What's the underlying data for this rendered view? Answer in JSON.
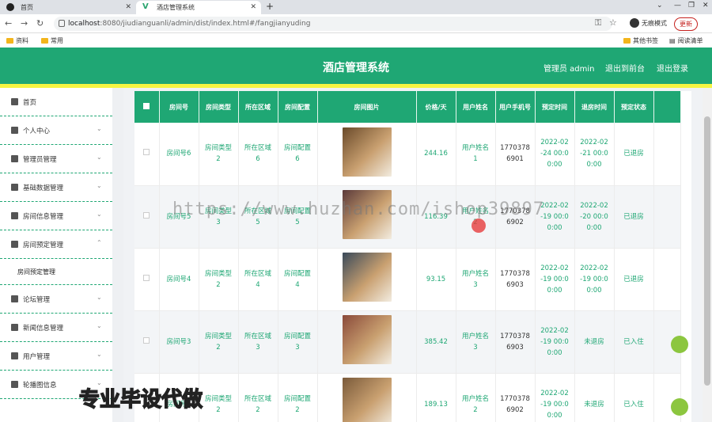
{
  "browser": {
    "tabs": [
      {
        "label": "首页"
      },
      {
        "label": "酒店管理系统"
      }
    ],
    "url_host": "localhost",
    "url_rest": ":8080/jiudianguanli/admin/dist/index.html#/fangjianyuding",
    "incognito_label": "无痕模式",
    "update_label": "更新",
    "bookmarks": [
      "资料",
      "常用"
    ],
    "bookmarks_right": [
      "其他书签",
      "阅读清单"
    ]
  },
  "header": {
    "title": "酒店管理系统",
    "admin": "管理员 admin",
    "back_front": "退出到前台",
    "logout": "退出登录"
  },
  "sidebar": {
    "items": [
      {
        "label": "首页",
        "icon": "home-icon",
        "chevron": false
      },
      {
        "label": "个人中心",
        "icon": "user-icon",
        "chevron": true
      },
      {
        "label": "管理员管理",
        "icon": "chart-icon",
        "chevron": true
      },
      {
        "label": "基础数据管理",
        "icon": "chat-icon",
        "chevron": true
      },
      {
        "label": "房间信息管理",
        "icon": "grid-icon",
        "chevron": true
      },
      {
        "label": "房间预定管理",
        "icon": "briefcase-icon",
        "chevron": true,
        "expanded": true
      },
      {
        "label": "论坛管理",
        "icon": "pin-icon",
        "chevron": true
      },
      {
        "label": "新闻信息管理",
        "icon": "news-icon",
        "chevron": true
      },
      {
        "label": "用户管理",
        "icon": "sliders-icon",
        "chevron": true
      },
      {
        "label": "轮播图信息",
        "icon": "bowtie-icon",
        "chevron": true
      }
    ],
    "subitem": "房间预定管理"
  },
  "table": {
    "headers": [
      "房间号",
      "房间类型",
      "所在区域",
      "房间配置",
      "房间图片",
      "价格/天",
      "用户姓名",
      "用户手机号",
      "预定时间",
      "退房时间",
      "预定状态"
    ],
    "rows": [
      {
        "room": "房间号6",
        "type": "房间类型\n2",
        "area": "所在区域\n6",
        "config": "房间配置\n6",
        "price": "244.16",
        "user": "用户姓名\n1",
        "phone": "1770378\n6901",
        "book": "2022-02\n-24 00:0\n0:00",
        "checkout": "2022-02\n-21 00:0\n0:00",
        "status": "已退房",
        "photo": "#6a4a2a"
      },
      {
        "room": "房间号5",
        "type": "房间类型\n3",
        "area": "所在区域\n5",
        "config": "房间配置\n5",
        "price": "116.39",
        "user": "用户姓名\n2",
        "phone": "1770378\n6902",
        "book": "2022-02\n-19 00:0\n0:00",
        "checkout": "2022-02\n-20 00:0\n0:00",
        "status": "已退房",
        "photo": "#5b3a3a"
      },
      {
        "room": "房间号4",
        "type": "房间类型\n2",
        "area": "所在区域\n4",
        "config": "房间配置\n4",
        "price": "93.15",
        "user": "用户姓名\n3",
        "phone": "1770378\n6903",
        "book": "2022-02\n-19 00:0\n0:00",
        "checkout": "2022-02\n-19 00:0\n0:00",
        "status": "已退房",
        "photo": "#3a4a5a"
      },
      {
        "room": "房间号3",
        "type": "房间类型\n2",
        "area": "所在区域\n3",
        "config": "房间配置\n3",
        "price": "385.42",
        "user": "用户姓名\n3",
        "phone": "1770378\n6903",
        "book": "2022-02\n-19 00:0\n0:00",
        "checkout": "未退房",
        "status": "已入住",
        "photo": "#8a4a3a"
      },
      {
        "room": "房间号2",
        "type": "房间类型\n2",
        "area": "所在区域\n2",
        "config": "房间配置\n2",
        "price": "189.13",
        "user": "用户姓名\n2",
        "phone": "1770378\n6902",
        "book": "2022-02\n-19 00:0\n0:00",
        "checkout": "未退房",
        "status": "已入住",
        "photo": "#7a5a3a"
      }
    ]
  },
  "overlay": {
    "watermark": "https://www.huzhan.com/ishop39897",
    "promo": "专业毕设代做"
  }
}
